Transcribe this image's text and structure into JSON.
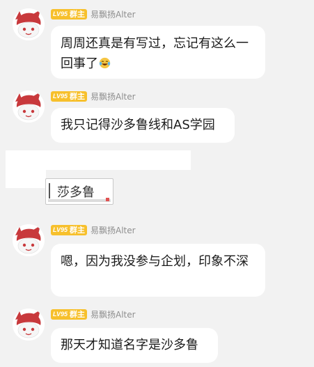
{
  "theme": {
    "bubble_bg": "#ffffff",
    "badge_bg": "#f7c02c",
    "nick_color": "#8f8f8f",
    "page_bg": "#f2f2f2"
  },
  "messages": [
    {
      "sender": {
        "level": "LV95",
        "role": "群主",
        "nickname": "易飘扬Alter",
        "avatar": "red-mascot-avatar"
      },
      "text": "周周还真是有写过，忘记有这么一回事了",
      "emoji": "laughing-tears-emoji"
    },
    {
      "sender": {
        "level": "LV95",
        "role": "群主",
        "nickname": "易飘扬Alter",
        "avatar": "red-mascot-avatar"
      },
      "text": "我只记得沙多鲁线和AS学园"
    },
    {
      "sticker_text": "莎多鲁"
    },
    {
      "sender": {
        "level": "LV95",
        "role": "群主",
        "nickname": "易飘扬Alter",
        "avatar": "red-mascot-avatar"
      },
      "text": "嗯，因为我没参与企划，印象不深"
    },
    {
      "sender": {
        "level": "LV95",
        "role": "群主",
        "nickname": "易飘扬Alter",
        "avatar": "red-mascot-avatar"
      },
      "text": "那天才知道名字是沙多鲁"
    }
  ]
}
